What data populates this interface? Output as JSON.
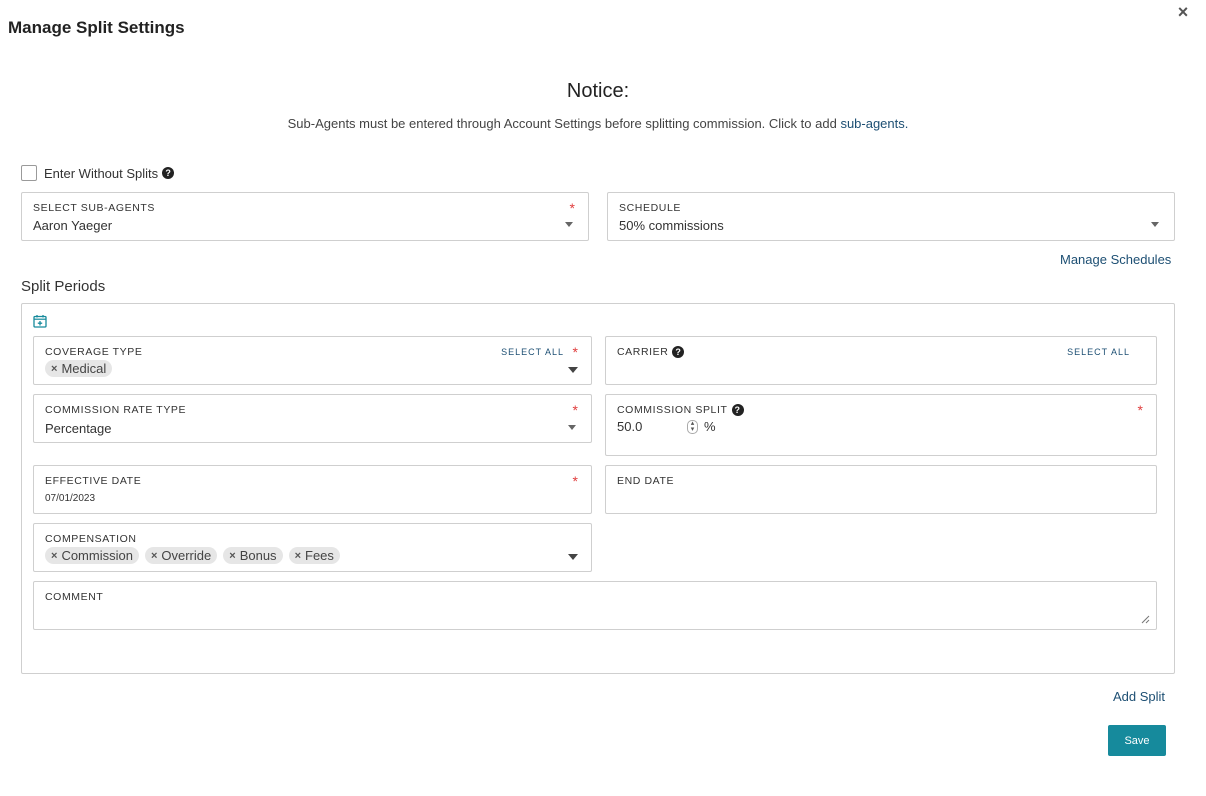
{
  "modal": {
    "title": "Manage Split Settings",
    "close_label": "×"
  },
  "notice": {
    "heading": "Notice:",
    "text": "Sub-Agents must be entered through Account Settings before splitting commission. Click to add ",
    "link": "sub-agents."
  },
  "enter_without_splits": {
    "label": "Enter Without Splits",
    "checked": false
  },
  "sub_agents": {
    "label": "SELECT SUB-AGENTS",
    "value": "Aaron Yaeger",
    "required_mark": "*"
  },
  "schedule": {
    "label": "SCHEDULE",
    "value": "50% commissions"
  },
  "manage_schedules_label": "Manage Schedules",
  "split_periods_title": "Split Periods",
  "coverage_type": {
    "label": "COVERAGE TYPE",
    "select_all": "SELECT ALL",
    "required_mark": "*",
    "chips": [
      "Medical"
    ]
  },
  "carrier": {
    "label": "CARRIER",
    "select_all": "SELECT ALL"
  },
  "commission_rate_type": {
    "label": "COMMISSION RATE TYPE",
    "value": "Percentage",
    "required_mark": "*"
  },
  "commission_split": {
    "label": "COMMISSION SPLIT",
    "value": "50.0",
    "unit": "%",
    "required_mark": "*"
  },
  "effective_date": {
    "label": "EFFECTIVE DATE",
    "value": "07/01/2023",
    "required_mark": "*"
  },
  "end_date": {
    "label": "END DATE",
    "value": ""
  },
  "compensation": {
    "label": "COMPENSATION",
    "chips": [
      "Commission",
      "Override",
      "Bonus",
      "Fees"
    ]
  },
  "comment": {
    "label": "COMMENT",
    "value": ""
  },
  "add_split_label": "Add Split",
  "save_label": "Save",
  "colors": {
    "accent": "#168a9c",
    "link": "#1d4f73",
    "required": "#e03c3c"
  },
  "icons": {
    "help": "question-circle-icon",
    "calendar_add": "calendar-plus-icon",
    "chip_remove": "x-icon"
  }
}
